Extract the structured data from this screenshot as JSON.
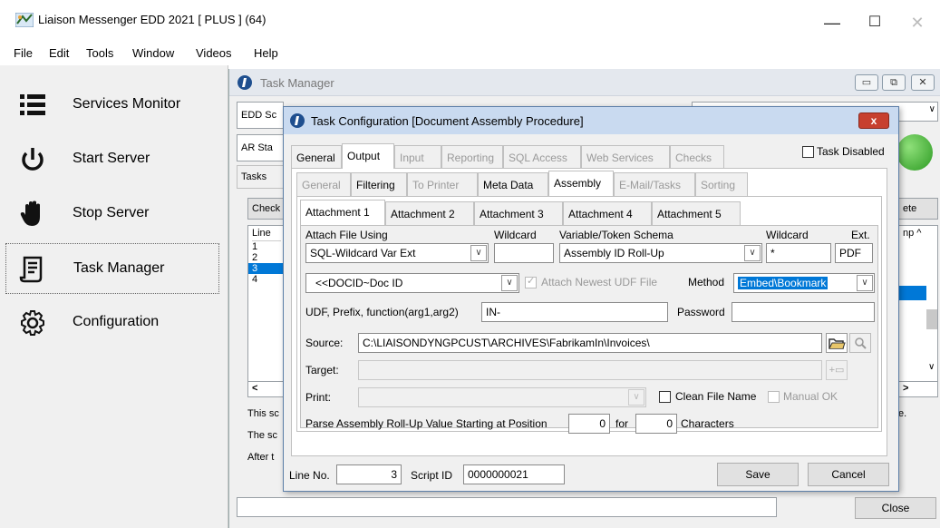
{
  "window": {
    "title": "Liaison Messenger EDD 2021 [ PLUS ] (64)",
    "minimize": "—",
    "maximize": "☐",
    "close": "✕"
  },
  "menu": [
    "File",
    "Edit",
    "Tools",
    "Window",
    "Videos",
    "Help"
  ],
  "sidebar": {
    "items": [
      {
        "label": "Services Monitor",
        "icon": "list-icon"
      },
      {
        "label": "Start Server",
        "icon": "power-icon"
      },
      {
        "label": "Stop Server",
        "icon": "hand-icon"
      },
      {
        "label": "Task Manager",
        "icon": "task-scroll-icon"
      },
      {
        "label": "Configuration",
        "icon": "gear-icon"
      }
    ]
  },
  "task_manager": {
    "title": "Task Manager",
    "bg": {
      "edd_sc": "EDD Sc",
      "ar_sta": "AR Sta",
      "tasks": "Tasks",
      "check": "Check",
      "delete": "ete",
      "line_header": "Line",
      "lines": [
        "1",
        "2",
        "3",
        "4"
      ],
      "comp_header": "np ^",
      "hscroll_left": "<",
      "hscroll_right": ">",
      "desc1": "This sc",
      "desc2": "The sc",
      "desc3": "After t",
      "close": "Close"
    }
  },
  "dialog": {
    "title": "Task Configuration [Document Assembly Procedure]",
    "close": "x",
    "tabs1": [
      "General",
      "Output",
      "Input",
      "Reporting",
      "SQL Access",
      "Web Services",
      "Checks"
    ],
    "task_disabled": "Task Disabled",
    "tabs2": [
      "General",
      "Filtering",
      "To Printer",
      "Meta Data",
      "Assembly",
      "E-Mail/Tasks",
      "Sorting"
    ],
    "tabs3": [
      "Attachment 1",
      "Attachment 2",
      "Attachment 3",
      "Attachment 4",
      "Attachment 5"
    ],
    "attach_file_using_label": "Attach File Using",
    "attach_file_using_value": "SQL-Wildcard Var Ext",
    "wildcard1_label": "Wildcard",
    "variable_schema_label": "Variable/Token Schema",
    "variable_schema_value": "Assembly ID Roll-Up",
    "wildcard2_label": "Wildcard",
    "wildcard2_value": "*",
    "ext_label": "Ext.",
    "ext_value": "PDF",
    "docid_value": "<<DOCID~Doc ID",
    "attach_newest_label": "Attach Newest UDF File",
    "method_label": "Method",
    "method_value": "Embed\\Bookmark",
    "udf_label": "UDF, Prefix, function(arg1,arg2)",
    "udf_value": "IN-",
    "password_label": "Password",
    "source_label": "Source:",
    "source_value": "C:\\LIAISONDYNGPCUST\\ARCHIVES\\FabrikamIn\\Invoices\\",
    "target_label": "Target:",
    "print_label": "Print:",
    "clean_file_name": "Clean File Name",
    "manual_ok": "Manual OK",
    "parse_label": "Parse Assembly Roll-Up Value Starting at Position",
    "parse_start": "0",
    "for_label": "for",
    "parse_len": "0",
    "characters_label": "Characters",
    "line_no_label": "Line No.",
    "line_no_value": "3",
    "script_id_label": "Script ID",
    "script_id_value": "0000000021",
    "save": "Save",
    "cancel": "Cancel"
  }
}
